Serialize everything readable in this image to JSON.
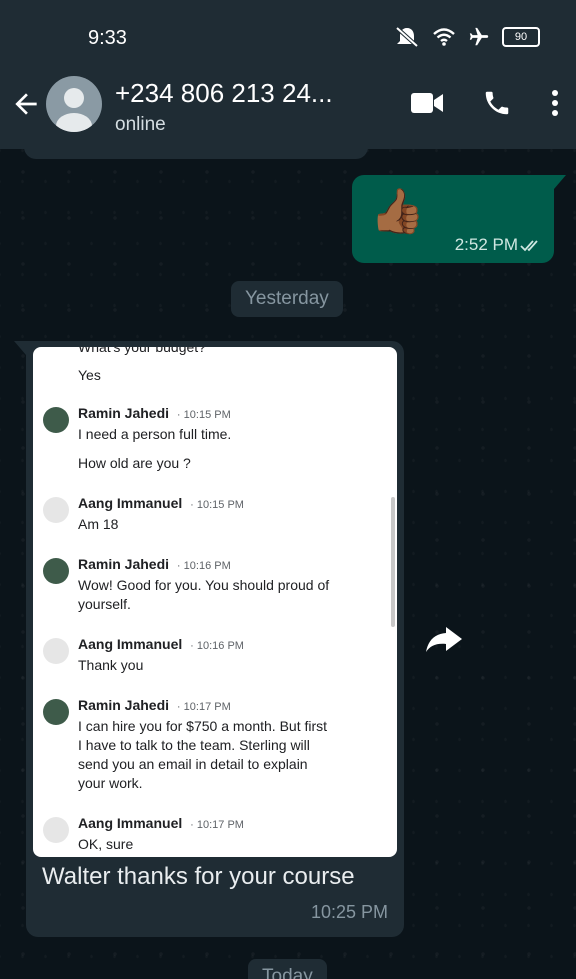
{
  "status_bar": {
    "time": "9:33",
    "battery": "90"
  },
  "header": {
    "contact_name": "+234 806 213 24...",
    "status": "online"
  },
  "messages": {
    "outgoing": {
      "emoji": "👍🏾",
      "time": "2:52 PM"
    },
    "date_yesterday": "Yesterday",
    "incoming": {
      "caption": "Walter thanks for your course",
      "time": "10:25 PM",
      "screenshot": {
        "cut_line": "What's your budget?",
        "first_line": "Yes",
        "items": [
          {
            "name": "Ramin Jahedi",
            "time": "10:15 PM",
            "lines": [
              "I need a person full time."
            ],
            "extra": "How old are you ?"
          },
          {
            "name": "Aang Immanuel",
            "time": "10:15 PM",
            "lines": [
              "Am 18"
            ]
          },
          {
            "name": "Ramin Jahedi",
            "time": "10:16 PM",
            "lines": [
              "Wow! Good for you. You should proud of",
              "yourself."
            ]
          },
          {
            "name": "Aang Immanuel",
            "time": "10:16 PM",
            "lines": [
              "Thank you"
            ]
          },
          {
            "name": "Ramin Jahedi",
            "time": "10:17 PM",
            "lines": [
              "I can hire you for $750 a month. But first",
              "I have to talk to the team. Sterling will",
              "send you an email in detail to explain",
              "your work."
            ]
          },
          {
            "name": "Aang Immanuel",
            "time": "10:17 PM",
            "lines": [
              "OK, sure"
            ]
          }
        ]
      }
    },
    "date_today": "Today"
  },
  "colors": {
    "header_bg": "#1f2c34",
    "chat_bg": "#0b141a",
    "outgoing_bubble": "#005c4b",
    "incoming_bubble": "#1f2c34"
  },
  "icons": [
    "mute-icon",
    "wifi-icon",
    "airplane-icon",
    "battery-icon",
    "back-arrow-icon",
    "video-call-icon",
    "phone-icon",
    "more-vert-icon",
    "double-tick-icon",
    "forward-icon"
  ]
}
